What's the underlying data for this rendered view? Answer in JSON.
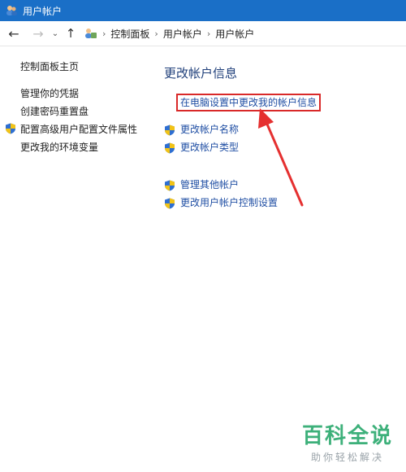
{
  "window": {
    "title": "用户帐户"
  },
  "nav": {
    "breadcrumb": [
      "控制面板",
      "用户帐户",
      "用户帐户"
    ]
  },
  "sidebar": {
    "home": "控制面板主页",
    "items": [
      {
        "label": "管理你的凭据",
        "shield": false
      },
      {
        "label": "创建密码重置盘",
        "shield": false
      },
      {
        "label": "配置高级用户配置文件属性",
        "shield": true
      },
      {
        "label": "更改我的环境变量",
        "shield": false
      }
    ]
  },
  "main": {
    "title": "更改帐户信息",
    "highlight_link": "在电脑设置中更改我的帐户信息",
    "tasks": [
      {
        "label": "更改帐户名称"
      },
      {
        "label": "更改帐户类型"
      },
      {
        "label": "管理其他帐户"
      },
      {
        "label": "更改用户帐户控制设置"
      }
    ]
  },
  "watermark": {
    "main": "百科全说",
    "sub": "助你轻松解决"
  },
  "colors": {
    "titlebar": "#1a6fc7",
    "link": "#1f4ea3",
    "annotation": "#d92929",
    "watermark": "#3db07a"
  }
}
